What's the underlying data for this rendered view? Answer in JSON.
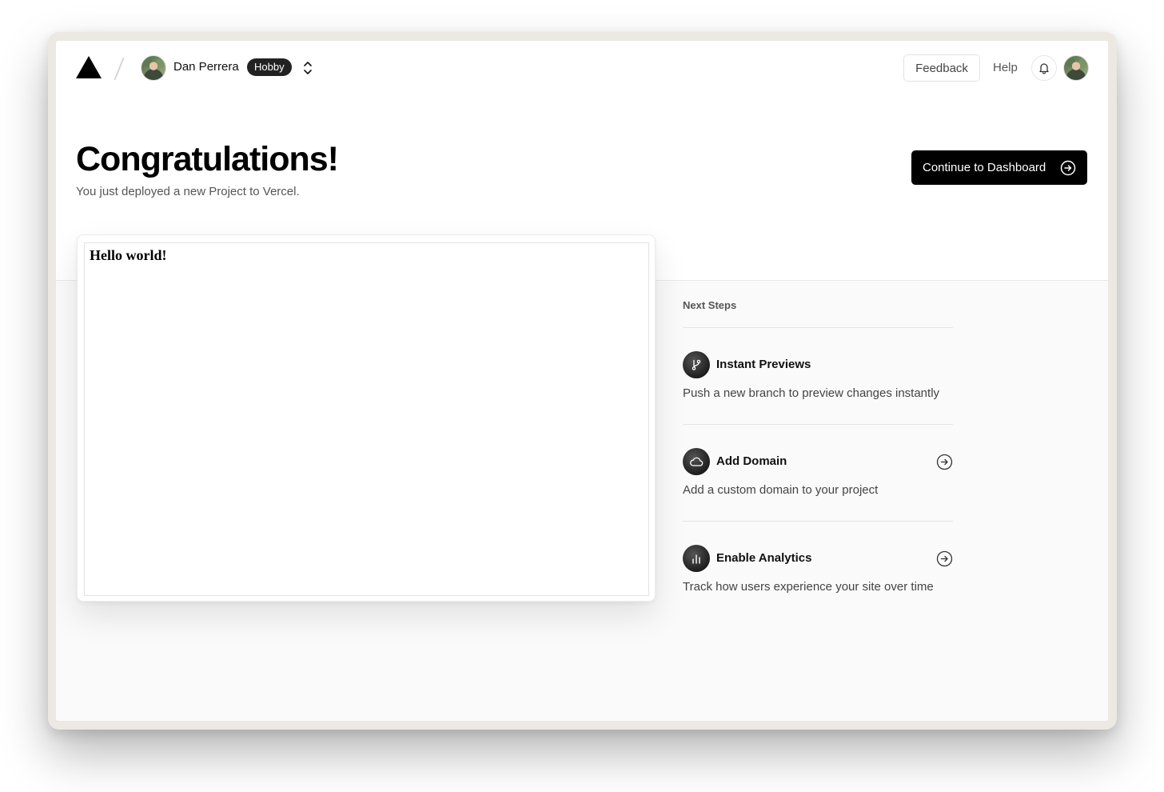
{
  "header": {
    "team_name": "Dan Perrera",
    "plan_badge": "Hobby",
    "feedback_label": "Feedback",
    "help_label": "Help",
    "icons": [
      "vercel-logo-icon",
      "team-avatar",
      "chevron-up-down-icon",
      "bell-icon",
      "user-avatar"
    ]
  },
  "hero": {
    "title": "Congratulations!",
    "subtitle": "You just deployed a new Project to Vercel.",
    "cta_label": "Continue to Dashboard",
    "cta_icon": "arrow-right-circle-icon"
  },
  "preview": {
    "content": "Hello world!"
  },
  "next_steps": {
    "heading": "Next Steps",
    "items": [
      {
        "title": "Instant Previews",
        "description": "Push a new branch to preview changes instantly",
        "icon": "git-branch-icon",
        "has_arrow": false
      },
      {
        "title": "Add Domain",
        "description": "Add a custom domain to your project",
        "icon": "cloud-icon",
        "has_arrow": true
      },
      {
        "title": "Enable Analytics",
        "description": "Track how users experience your site over time",
        "icon": "bar-chart-icon",
        "has_arrow": true
      }
    ]
  },
  "colors": {
    "primary": "#000000",
    "frame": "#ece8e2",
    "lower_band": "#fafafa",
    "badge_bg": "#222222"
  }
}
